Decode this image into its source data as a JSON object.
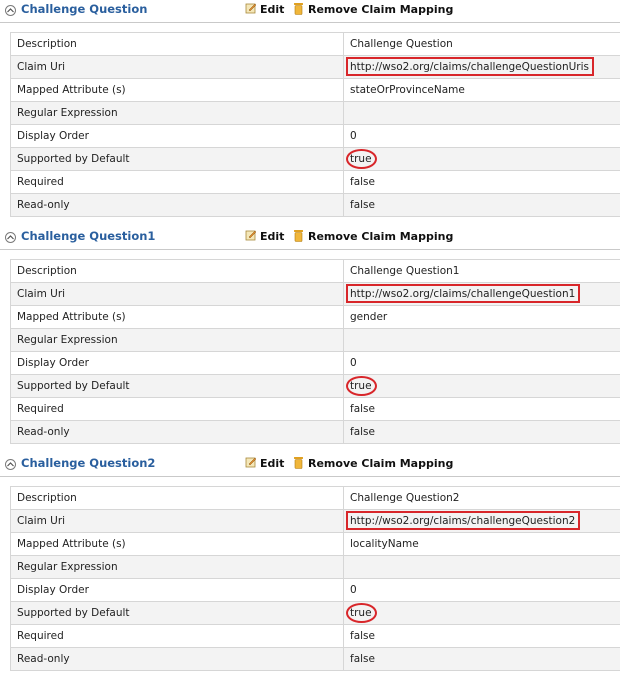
{
  "actions": {
    "edit": "Edit",
    "remove": "Remove Claim Mapping"
  },
  "labels": {
    "description": "Description",
    "claim_uri": "Claim Uri",
    "mapped_attribute": "Mapped Attribute (s)",
    "regex": "Regular Expression",
    "display_order": "Display Order",
    "supported": "Supported by Default",
    "required": "Required",
    "read_only": "Read-only"
  },
  "claims": [
    {
      "title": "Challenge Question",
      "description": "Challenge Question",
      "claim_uri": "http://wso2.org/claims/challengeQuestionUris",
      "mapped_attribute": "stateOrProvinceName",
      "regex": "",
      "display_order": "0",
      "supported": "true",
      "required": "false",
      "read_only": "false"
    },
    {
      "title": "Challenge Question1",
      "description": "Challenge Question1",
      "claim_uri": "http://wso2.org/claims/challengeQuestion1",
      "mapped_attribute": "gender",
      "regex": "",
      "display_order": "0",
      "supported": "true",
      "required": "false",
      "read_only": "false"
    },
    {
      "title": "Challenge Question2",
      "description": "Challenge Question2",
      "claim_uri": "http://wso2.org/claims/challengeQuestion2",
      "mapped_attribute": "localityName",
      "regex": "",
      "display_order": "0",
      "supported": "true",
      "required": "false",
      "read_only": "false"
    }
  ],
  "colors": {
    "title": "#2a5f9e",
    "highlight": "#d8262a"
  }
}
